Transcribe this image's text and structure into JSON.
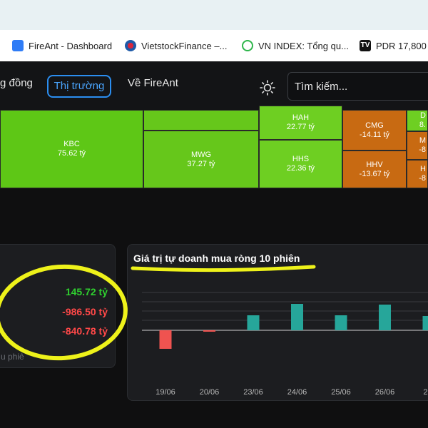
{
  "bookmarks": [
    {
      "label": "FireAnt - Dashboard",
      "icon": "fireant-icon"
    },
    {
      "label": "VietstockFinance –...",
      "icon": "vietstock-icon"
    },
    {
      "label": "VN INDEX: Tổng qu...",
      "icon": "vnindex-icon"
    },
    {
      "label": "PDR 17,800",
      "icon": "tradingview-icon"
    }
  ],
  "nav": {
    "items": [
      "g đồng",
      "Thị trường",
      "Về FireAnt"
    ],
    "active_index": 1
  },
  "search": {
    "placeholder": "Tìm kiếm..."
  },
  "treemap": {
    "tiles": [
      {
        "symbol": "KBC",
        "value": "75.62 tỷ",
        "color": "#5ec716"
      },
      {
        "symbol": "MWG",
        "value": "37.27 tỷ",
        "color": "#66c71b"
      },
      {
        "symbol": "HAH",
        "value": "22.77 tỷ",
        "color": "#6ecf22"
      },
      {
        "symbol": "HHS",
        "value": "22.36 tỷ",
        "color": "#6ecf22"
      },
      {
        "symbol": "CMG",
        "value": "-14.11 tỷ",
        "color": "#c86a12"
      },
      {
        "symbol": "HHV",
        "value": "-13.67 tỷ",
        "color": "#c86a12"
      },
      {
        "symbol": "D",
        "value": "8.",
        "color": "#6ecf22"
      },
      {
        "symbol": "M",
        "value": "-8",
        "color": "#c86a12"
      },
      {
        "symbol": "H",
        "value": "-8",
        "color": "#c86a12"
      }
    ]
  },
  "stats": {
    "values": [
      "145.72 tỷ",
      "-986.50 tỷ",
      "-840.78 tỷ"
    ],
    "footer": "u phiê"
  },
  "chart": {
    "title": "Giá trị tự doanh mua ròng 10 phiên"
  },
  "chart_data": {
    "type": "bar",
    "title": "Giá trị tự doanh mua ròng 10 phiên",
    "categories": [
      "19/06",
      "20/06",
      "23/06",
      "24/06",
      "25/06",
      "26/06",
      "27/"
    ],
    "values": [
      -26,
      -2,
      21,
      37,
      21,
      36,
      20
    ],
    "positive_color": "#26a69a",
    "negative_color": "#ef5350",
    "grid": true,
    "ylim": [
      -40,
      55
    ]
  },
  "colors": {
    "accent": "#2b8ef0",
    "up": "#2fcf2f",
    "down": "#ff4848",
    "highlight": "#eef21a"
  }
}
